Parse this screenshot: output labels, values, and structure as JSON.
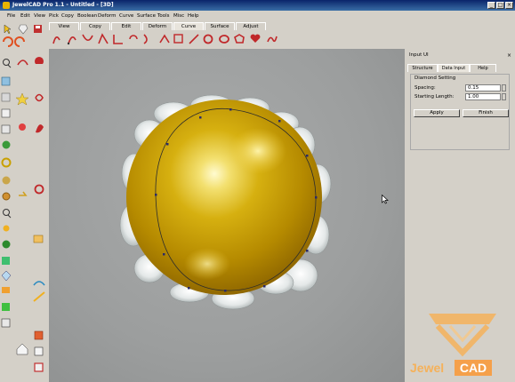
{
  "window": {
    "title": "JewelCAD Pro 1.1 - Untitled - [3D]"
  },
  "menu": [
    "File",
    "Edit",
    "View",
    "Pick",
    "Copy",
    "Boolean",
    "Deform",
    "Curve",
    "Surface",
    "Tools",
    "Misc",
    "Help"
  ],
  "tabs": [
    {
      "label": "View"
    },
    {
      "label": "Copy"
    },
    {
      "label": "Edit"
    },
    {
      "label": "Deform"
    },
    {
      "label": "Curve",
      "active": true
    },
    {
      "label": "Surface"
    },
    {
      "label": "Adjust"
    }
  ],
  "panel": {
    "title": "Input UI",
    "tabs": [
      {
        "label": "Structure"
      },
      {
        "label": "Data Input",
        "active": true
      },
      {
        "label": "Help"
      }
    ],
    "group_label": "Diamond Setting",
    "spacing_label": "Spacing:",
    "spacing_value": "0.15",
    "start_label": "Starting Length:",
    "start_value": "1.00",
    "apply_label": "Apply",
    "finish_label": "Finish"
  },
  "logo": {
    "part1": "Jewel",
    "part2": "CAD"
  },
  "colors": {
    "accent_orange": "#f5a04a",
    "gold": "#d4a800",
    "title_blue": "#0a246a",
    "curve_red": "#c0282a"
  }
}
